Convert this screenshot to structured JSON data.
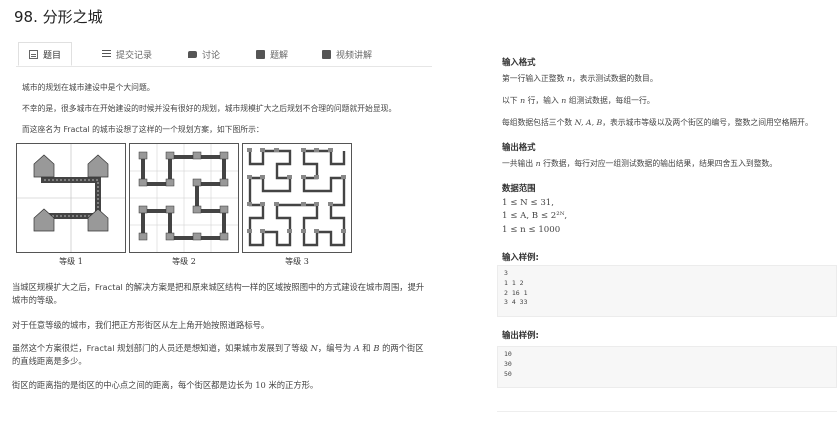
{
  "page_title": "98. 分形之城",
  "tabs": [
    {
      "label": "题目",
      "icon": "document-icon"
    },
    {
      "label": "提交记录",
      "icon": "list-icon"
    },
    {
      "label": "讨论",
      "icon": "chat-icon"
    },
    {
      "label": "题解",
      "icon": "book-icon"
    },
    {
      "label": "视频讲解",
      "icon": "video-icon"
    }
  ],
  "left": {
    "intro1": "城市的规划在城市建设中是个大问题。",
    "intro2": "不幸的是，很多城市在开始建设的时候并没有很好的规划，城市规模扩大之后规划不合理的问题就开始显现。",
    "intro3": "而这座名为 Fractal 的城市设想了这样的一个规划方案，如下图所示：",
    "captions": [
      "等级 1",
      "等级 2",
      "等级 3"
    ],
    "para1_l1": "当城区规模扩大之后，Fractal 的解决方案是把和原来城区结构一样的区域按照图中的方式建设在城市周围，提升",
    "para1_l2": "城市的等级。",
    "para2": "对于任意等级的城市，我们把正方形街区从左上角开始按照道路标号。",
    "para3_l1a": "虽然这个方案很烂，Fractal 规划部门的人员还是想知道，如果城市发展到了等级 ",
    "para3_l1_N": "N",
    "para3_l1b": "，编号为 ",
    "para3_l1_A": "A",
    "para3_l1c": " 和 ",
    "para3_l1_B": "B",
    "para3_l1d": " 的两个街区",
    "para3_l2": "的直线距离是多少。",
    "para4a": "街区的距离指的是街区的中心点之间的距离，每个街区都是边长为 ",
    "para4_num": "10",
    "para4b": " 米的正方形。"
  },
  "right": {
    "input_format_title": "输入格式",
    "input_l1a": "第一行输入正整数 ",
    "input_l1_n": "n",
    "input_l1b": "，表示测试数据的数目。",
    "input_l2a": "以下 ",
    "input_l2_n1": "n",
    "input_l2b": " 行，输入 ",
    "input_l2_n2": "n",
    "input_l2c": " 组测试数据，每组一行。",
    "input_l3a": "每组数据包括三个数 ",
    "input_l3_vars": "N, A, B",
    "input_l3b": "，表示城市等级以及两个街区的编号，整数之间用空格隔开。",
    "output_format_title": "输出格式",
    "output_l1a": "一共输出 ",
    "output_l1_n": "n",
    "output_l1b": " 行数据，每行对应一组测试数据的输出结果，结果四舍五入到整数。",
    "range_title": "数据范围",
    "range1": "1 ≤ N ≤ 31,",
    "range2": "1 ≤ A, B ≤ 2²ᴺ,",
    "range3": "1 ≤ n ≤ 1000",
    "sample_in_title": "输入样例:",
    "sample_in": [
      "3",
      "1 1 2",
      "2 16 1",
      "3 4 33"
    ],
    "sample_out_title": "输出样例:",
    "sample_out": [
      "10",
      "30",
      "50"
    ]
  }
}
